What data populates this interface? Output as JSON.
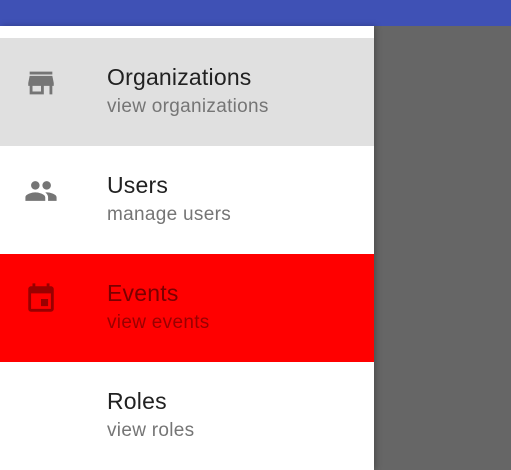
{
  "colors": {
    "app_bar": "#3f51b5",
    "scrim": "#666666",
    "drawer": "#ffffff",
    "hover_item_bg": "#e0e0e0",
    "selected_item_bg": "#ff0000",
    "icon": "#757575",
    "selected_icon": "#990000"
  },
  "drawer": {
    "items": [
      {
        "title": "Organizations",
        "subtitle": "view organizations",
        "icon": "store-icon",
        "state": "hover"
      },
      {
        "title": "Users",
        "subtitle": "manage users",
        "icon": "people-icon",
        "state": "normal"
      },
      {
        "title": "Events",
        "subtitle": "view events",
        "icon": "calendar-icon",
        "state": "selected"
      },
      {
        "title": "Roles",
        "subtitle": "view roles",
        "icon": "",
        "state": "normal"
      }
    ]
  }
}
